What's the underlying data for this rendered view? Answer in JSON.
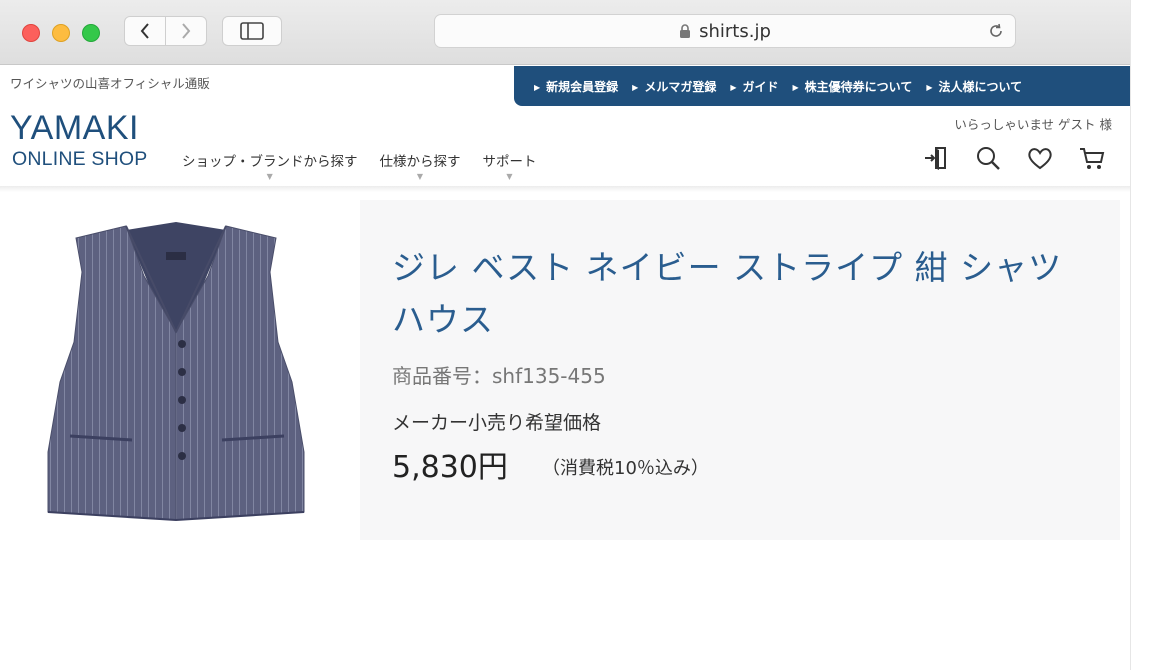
{
  "browser": {
    "url": "shirts.jp"
  },
  "site": {
    "tagline": "ワイシャツの山喜オフィシャル通販",
    "logo": {
      "word": "YAMAKI",
      "sub": "ONLINE SHOP"
    },
    "top_nav": [
      "新規会員登録",
      "メルマガ登録",
      "ガイド",
      "株主優待券について",
      "法人様について"
    ],
    "main_nav": [
      "ショップ・ブランドから探す",
      "仕様から探す",
      "サポート"
    ],
    "greeting": "いらっしゃいませ ゲスト 様",
    "brand_color": "#1f4f7c",
    "icons": [
      "login-icon",
      "search-icon",
      "heart-icon",
      "cart-icon"
    ]
  },
  "product": {
    "title": "ジレ ベスト ネイビー ストライプ 紺 シャツハウス",
    "code": "商品番号：shf135-455",
    "price_label": "メーカー小売り希望価格",
    "price": "5,830円",
    "tax_note": "（消費税10％込み）",
    "image": "navy-striped-vest",
    "title_color": "#2a5d8f"
  }
}
